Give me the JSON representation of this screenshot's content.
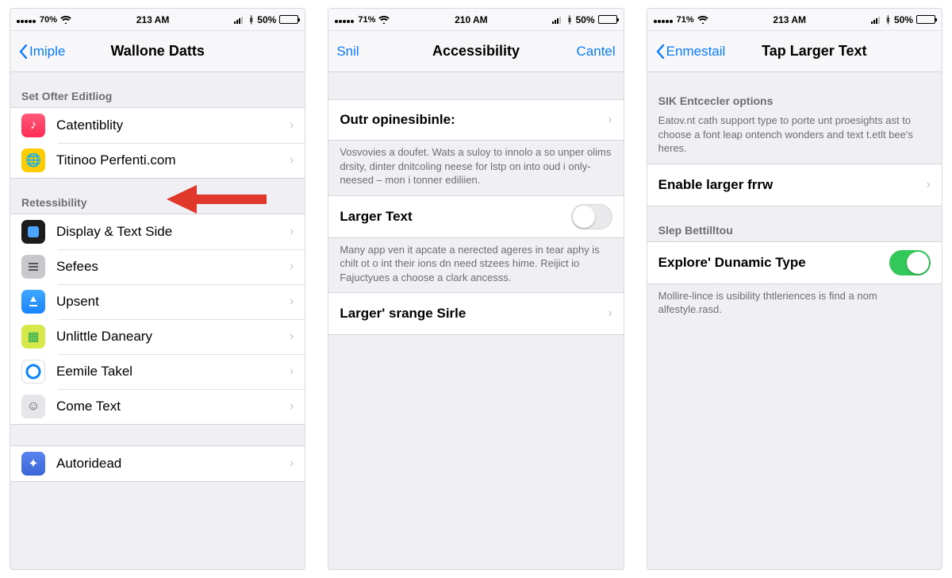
{
  "phones": [
    {
      "status": {
        "carrier": "70%",
        "time": "213 AM",
        "battery_text": "50%"
      },
      "nav": {
        "back": "Imiple",
        "title": "Wallone Datts"
      },
      "sections": [
        {
          "header": "Set Ofter Editliog",
          "rows": [
            {
              "icon": "music",
              "icon_bg": "#ff2d55",
              "label": "Catentiblity"
            },
            {
              "icon": "globe",
              "icon_bg": "#ffcc00",
              "label": "Titinoo Perfenti.com"
            }
          ]
        },
        {
          "header": "Retessibility",
          "rows": [
            {
              "icon": "display",
              "icon_bg": "#1c1c1e",
              "label": "Display & Text Side"
            },
            {
              "icon": "bars",
              "icon_bg": "#8e8e93",
              "label": "Sefees"
            },
            {
              "icon": "appstore",
              "icon_bg": "#1a84ff",
              "label": "Upsent"
            },
            {
              "icon": "cal",
              "icon_bg": "#c3d82e",
              "label": "Unlittle Daneary"
            },
            {
              "icon": "circle",
              "icon_bg": "#0a7aff",
              "label": "Eemile Takel"
            },
            {
              "icon": "face",
              "icon_bg": "#d1d1d6",
              "label": "Come Text"
            }
          ]
        },
        {
          "header": "",
          "rows": [
            {
              "icon": "game",
              "icon_bg": "#3a66d8",
              "label": "Autoridead"
            }
          ]
        }
      ]
    },
    {
      "status": {
        "carrier": "71%",
        "time": "210 AM",
        "battery_text": "50%"
      },
      "nav": {
        "left_plain": "Snil",
        "title": "Accessibility",
        "right": "Cantel"
      },
      "row1": {
        "label": "Outr opinesibinle:"
      },
      "desc1": "Vosvovies a doufet. Wats a suloy to innolo a so unper olims drsity, dinter dnitcoling neese for lstp on into oud i only-neesed – mon i tonner ediliien.",
      "row2": {
        "label": "Larger Text"
      },
      "desc2": "Many app ven it apcate a nerected ageres in tear aphy is chilt ot o int their ions dn need stzees hime. Reijict io Fajuctyues a choose a clark ancesss.",
      "row3": {
        "label": "Larger' srange Sirle"
      }
    },
    {
      "status": {
        "carrier": "71%",
        "time": "213 AM",
        "battery_text": "50%"
      },
      "nav": {
        "back": "Enmestail",
        "title": "Tap Larger Text"
      },
      "header1": "SIK Entcecler options",
      "desc1": "Eatov.nt cath support type to porte unt proesights ast to choose a font leap ontench wonders and text t.etlt bee's heres.",
      "row1": {
        "label": "Enable larger frrw"
      },
      "header2": "Slep Bettilltou",
      "row2": {
        "label": "Explore' Dunamic Type"
      },
      "desc2": "Mollire-lince is usibility thtleriences is find a nom alfestyle.rasd."
    }
  ]
}
